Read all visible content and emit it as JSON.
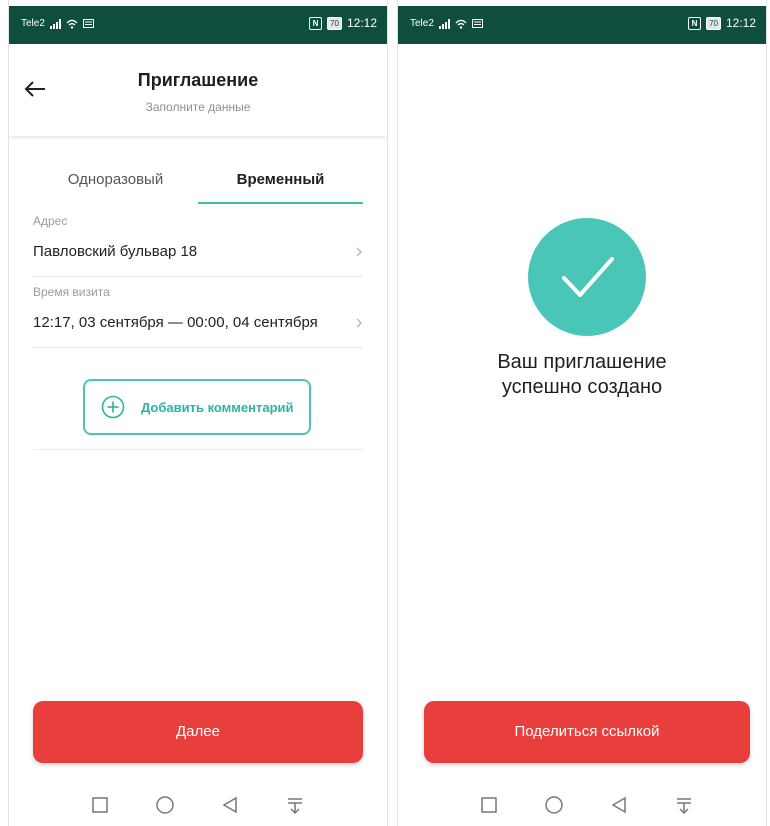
{
  "status_bar": {
    "carrier": "Tele2",
    "battery": "70",
    "time": "12:12"
  },
  "invite_form": {
    "header": {
      "title": "Приглашение",
      "subtitle": "Заполните данные"
    },
    "tabs": [
      {
        "label": "Одноразовый",
        "active": false
      },
      {
        "label": "Временный",
        "active": true
      }
    ],
    "address": {
      "label": "Адрес",
      "value": "Павловский бульвар 18"
    },
    "visit_time": {
      "label": "Время визита",
      "value": "12:17, 03 сентября — 00:00, 04 сентября"
    },
    "comment_button": {
      "label": "Добавить комментарий",
      "icon": "plus-circle-icon"
    },
    "next_button": {
      "label": "Далее"
    }
  },
  "success_screen": {
    "icon": "check-icon",
    "message_line1": "Ваш приглашение",
    "message_line2": "успешно создано",
    "share_button": {
      "label": "Поделиться ссылкой"
    }
  },
  "nav_bar": {
    "icons": [
      "square-icon",
      "circle-icon",
      "triangle-back-icon",
      "notification-down-icon"
    ]
  },
  "colors": {
    "status_bar": "#0d4f3c",
    "accent": "#39c1b0",
    "primary_button": "#e83e3c",
    "success_circle": "#49c6b7"
  }
}
